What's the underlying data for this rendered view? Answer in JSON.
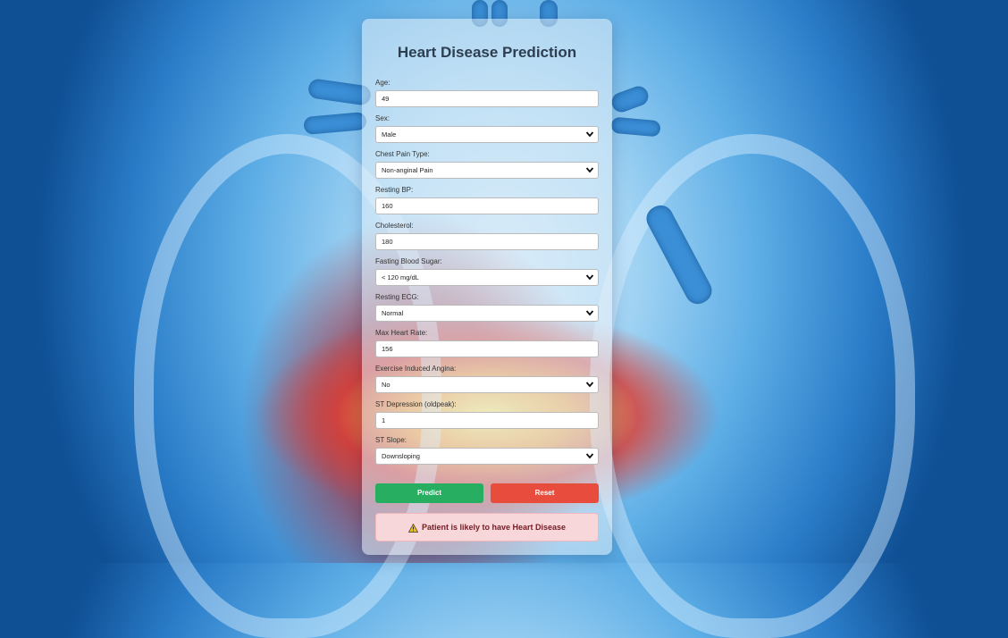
{
  "form": {
    "title": "Heart Disease Prediction",
    "fields": [
      {
        "label": "Age:",
        "value": "49",
        "type": "input"
      },
      {
        "label": "Sex:",
        "value": "Male",
        "type": "select"
      },
      {
        "label": "Chest Pain Type:",
        "value": "Non-anginal Pain",
        "type": "select"
      },
      {
        "label": "Resting BP:",
        "value": "160",
        "type": "input"
      },
      {
        "label": "Cholesterol:",
        "value": "180",
        "type": "input"
      },
      {
        "label": "Fasting Blood Sugar:",
        "value": "< 120 mg/dL",
        "type": "select"
      },
      {
        "label": "Resting ECG:",
        "value": "Normal",
        "type": "select"
      },
      {
        "label": "Max Heart Rate:",
        "value": "156",
        "type": "input"
      },
      {
        "label": "Exercise Induced Angina:",
        "value": "No",
        "type": "select"
      },
      {
        "label": "ST Depression (oldpeak):",
        "value": "1",
        "type": "input"
      },
      {
        "label": "ST Slope:",
        "value": "Downsloping",
        "type": "select"
      }
    ],
    "predict_label": "Predict",
    "reset_label": "Reset",
    "result_text": "Patient is likely to have Heart Disease",
    "result_icon": "warning-icon"
  },
  "colors": {
    "predict": "#27ae60",
    "reset": "#e74c3c",
    "result_bg": "#f8d7da",
    "result_text": "#721c24",
    "title": "#2c3e50"
  }
}
